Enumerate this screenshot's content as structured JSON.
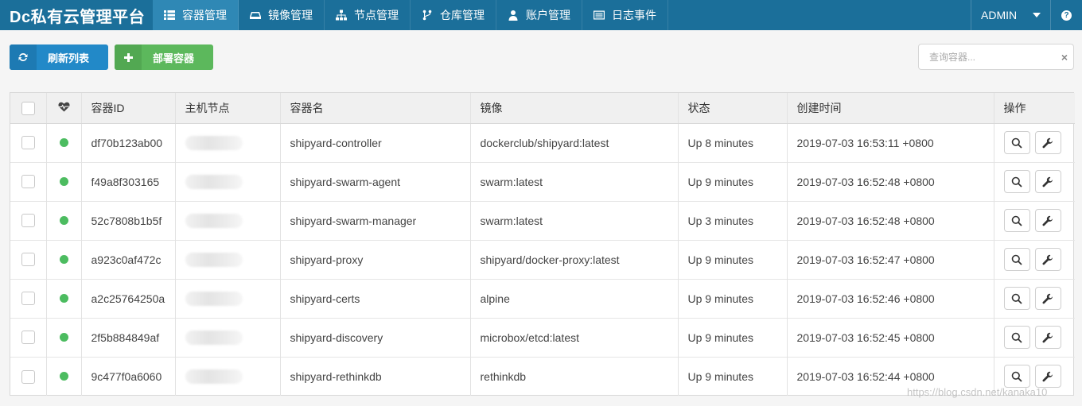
{
  "app": {
    "brand": "Dc私有云管理平台"
  },
  "nav": [
    {
      "label": "容器管理",
      "icon": "grid-icon",
      "active": true
    },
    {
      "label": "镜像管理",
      "icon": "drive-icon",
      "active": false
    },
    {
      "label": "节点管理",
      "icon": "sitemap-icon",
      "active": false
    },
    {
      "label": "仓库管理",
      "icon": "fork-icon",
      "active": false
    },
    {
      "label": "账户管理",
      "icon": "user-icon",
      "active": false
    },
    {
      "label": "日志事件",
      "icon": "list-icon",
      "active": false
    }
  ],
  "user": {
    "name": "ADMIN"
  },
  "help": {
    "label": "?"
  },
  "toolbar": {
    "refresh_label": "刷新列表",
    "deploy_label": "部署容器",
    "search_placeholder": "查询容器...",
    "clear_label": "×"
  },
  "table": {
    "headers": [
      "容器ID",
      "主机节点",
      "容器名",
      "镜像",
      "状态",
      "创建时间",
      "操作"
    ],
    "rows": [
      {
        "id": "df70b123ab00",
        "name": "shipyard-controller",
        "image": "dockerclub/shipyard:latest",
        "status": "Up 8 minutes",
        "created": "2019-07-03 16:53:11 +0800"
      },
      {
        "id": "f49a8f303165",
        "name": "shipyard-swarm-agent",
        "image": "swarm:latest",
        "status": "Up 9 minutes",
        "created": "2019-07-03 16:52:48 +0800"
      },
      {
        "id": "52c7808b1b5f",
        "name": "shipyard-swarm-manager",
        "image": "swarm:latest",
        "status": "Up 3 minutes",
        "created": "2019-07-03 16:52:48 +0800"
      },
      {
        "id": "a923c0af472c",
        "name": "shipyard-proxy",
        "image": "shipyard/docker-proxy:latest",
        "status": "Up 9 minutes",
        "created": "2019-07-03 16:52:47 +0800"
      },
      {
        "id": "a2c25764250a",
        "name": "shipyard-certs",
        "image": "alpine",
        "status": "Up 9 minutes",
        "created": "2019-07-03 16:52:46 +0800"
      },
      {
        "id": "2f5b884849af",
        "name": "shipyard-discovery",
        "image": "microbox/etcd:latest",
        "status": "Up 9 minutes",
        "created": "2019-07-03 16:52:45 +0800"
      },
      {
        "id": "9c477f0a6060",
        "name": "shipyard-rethinkdb",
        "image": "rethinkdb",
        "status": "Up 9 minutes",
        "created": "2019-07-03 16:52:44 +0800"
      }
    ]
  },
  "watermark": "https://blog.csdn.net/kanaka10",
  "colors": {
    "topbar": "#1b6f9a",
    "active_nav": "#2f88b5",
    "refresh": "#2289c8",
    "deploy": "#5cb85c",
    "running": "#4cbc60"
  }
}
